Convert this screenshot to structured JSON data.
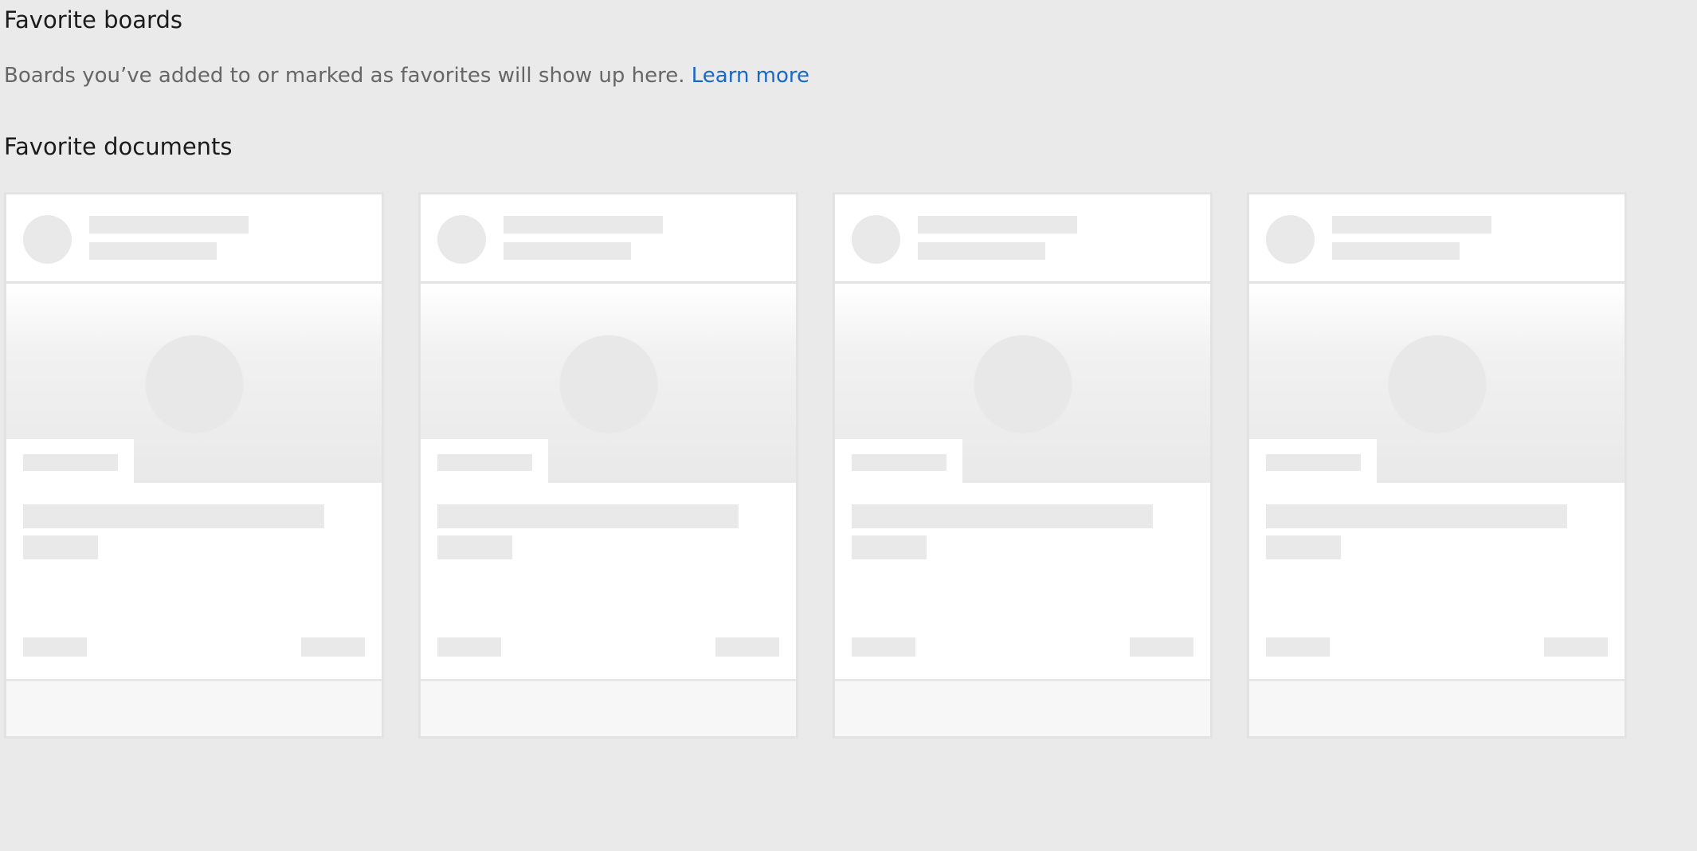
{
  "favorite_boards": {
    "heading": "Favorite boards",
    "description": "Boards you’ve added to or marked as favorites will show up here.",
    "learn_more_link": "Learn more"
  },
  "favorite_documents": {
    "heading": "Favorite documents",
    "loading_cards": 4
  },
  "colors": {
    "page_background": "#eaeaea",
    "link": "#1868c6",
    "placeholder": "#e9e9e9",
    "card_background": "#ffffff",
    "card_footer": "#f7f7f7"
  }
}
